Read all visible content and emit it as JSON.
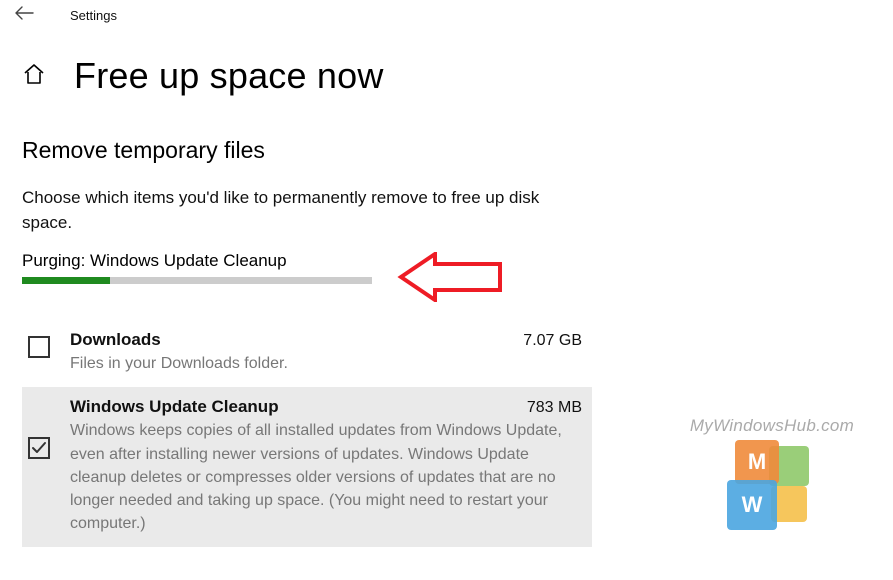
{
  "app": {
    "title": "Settings"
  },
  "page": {
    "title": "Free up space now",
    "section_title": "Remove temporary files",
    "section_desc": "Choose which items you'd like to permanently remove to free up disk space.",
    "status": "Purging: Windows Update Cleanup",
    "progress_percent": 25
  },
  "items": [
    {
      "checked": false,
      "name": "Downloads",
      "size": "7.07 GB",
      "desc": "Files in your Downloads folder."
    },
    {
      "checked": true,
      "name": "Windows Update Cleanup",
      "size": "783 MB",
      "desc": "Windows keeps copies of all installed updates from Windows Update, even after installing newer versions of updates. Windows Update cleanup deletes or compresses older versions of updates that are no longer needed and taking up space. (You might need to restart your computer.)"
    }
  ],
  "watermark": {
    "text": "MyWindowsHub.com",
    "m": "M",
    "w": "W"
  },
  "colors": {
    "accent_green": "#1f8a1f",
    "arrow": "#ee1c25"
  }
}
